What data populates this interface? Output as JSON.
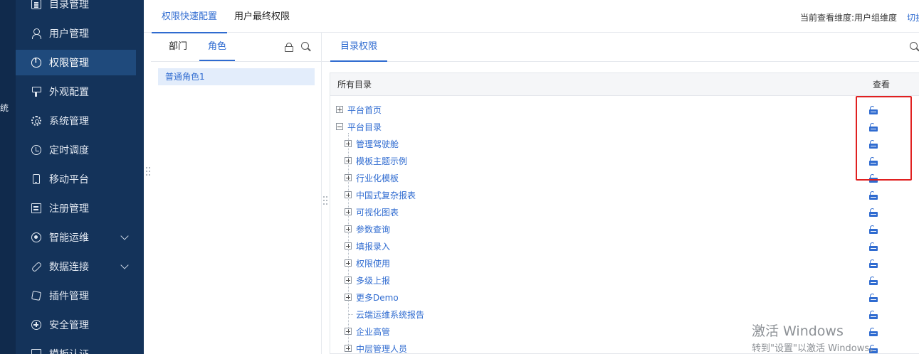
{
  "sidebar": {
    "partial_label": "统",
    "items": [
      {
        "name": "catalog",
        "label": "目录管理",
        "icon": "document-icon"
      },
      {
        "name": "users",
        "label": "用户管理",
        "icon": "user-icon"
      },
      {
        "name": "permissions",
        "label": "权限管理",
        "icon": "shield-icon",
        "active": true
      },
      {
        "name": "appearance",
        "label": "外观配置",
        "icon": "paint-brush-icon"
      },
      {
        "name": "system",
        "label": "系统管理",
        "icon": "gear-icon"
      },
      {
        "name": "schedule",
        "label": "定时调度",
        "icon": "clock-icon"
      },
      {
        "name": "mobile",
        "label": "移动平台",
        "icon": "phone-icon"
      },
      {
        "name": "registration",
        "label": "注册管理",
        "icon": "register-icon"
      },
      {
        "name": "smart-ops",
        "label": "智能运维",
        "icon": "ops-icon",
        "expandable": true
      },
      {
        "name": "data-connection",
        "label": "数据连接",
        "icon": "link-icon",
        "expandable": true
      },
      {
        "name": "plugins",
        "label": "插件管理",
        "icon": "plugin-icon"
      },
      {
        "name": "security",
        "label": "安全管理",
        "icon": "plus-shield-icon"
      },
      {
        "name": "template-cert",
        "label": "模板认证",
        "icon": "certificate-icon"
      }
    ]
  },
  "top_tabs": [
    {
      "label": "权限快速配置",
      "active": true
    },
    {
      "label": "用户最终权限",
      "active": false
    }
  ],
  "dimension": {
    "text": "当前查看维度:用户组维度",
    "switch_label": "切换"
  },
  "left_panel": {
    "tabs": [
      {
        "label": "部门",
        "active": false
      },
      {
        "label": "角色",
        "active": true
      }
    ],
    "roles": [
      "普通角色1"
    ]
  },
  "right_panel": {
    "tab_label": "目录权限",
    "columns": {
      "all": "所有目录",
      "view": "查看"
    },
    "tree": [
      {
        "label": "平台首页",
        "level": 0,
        "toggle": "plus"
      },
      {
        "label": "平台目录",
        "level": 0,
        "toggle": "minus"
      },
      {
        "label": "管理驾驶舱",
        "level": 1,
        "toggle": "plus"
      },
      {
        "label": "模板主题示例",
        "level": 1,
        "toggle": "plus"
      },
      {
        "label": "行业化模板",
        "level": 1,
        "toggle": "plus"
      },
      {
        "label": "中国式复杂报表",
        "level": 1,
        "toggle": "plus"
      },
      {
        "label": "可视化图表",
        "level": 1,
        "toggle": "plus"
      },
      {
        "label": "参数查询",
        "level": 1,
        "toggle": "plus"
      },
      {
        "label": "填报录入",
        "level": 1,
        "toggle": "plus"
      },
      {
        "label": "权限使用",
        "level": 1,
        "toggle": "plus"
      },
      {
        "label": "多级上报",
        "level": 1,
        "toggle": "plus"
      },
      {
        "label": "更多Demo",
        "level": 1,
        "toggle": "plus"
      },
      {
        "label": "云端运维系统报告",
        "level": 1,
        "toggle": "none"
      },
      {
        "label": "企业高管",
        "level": 1,
        "toggle": "plus"
      },
      {
        "label": "中层管理人员",
        "level": 1,
        "toggle": "plus"
      }
    ]
  },
  "watermark": {
    "line1": "激活 Windows",
    "line2": "转到\"设置\"以激活 Windows。"
  },
  "colors": {
    "accent": "#2f6bd0",
    "sidebar_bg": "#14335a",
    "sidebar_active": "#1f4a7c",
    "highlight_box": "#e02020"
  }
}
